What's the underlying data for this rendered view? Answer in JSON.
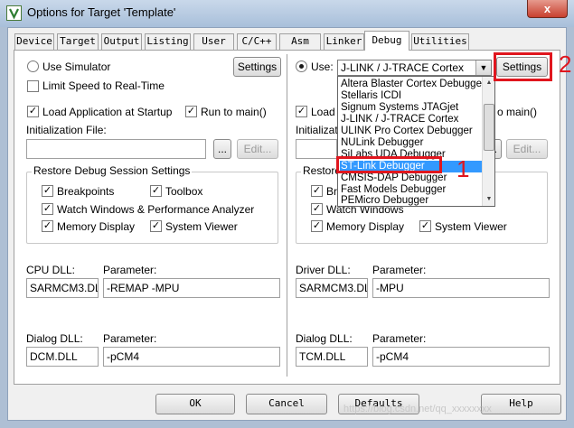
{
  "window": {
    "title": "Options for Target 'Template'",
    "close_label": "x"
  },
  "tabs": [
    {
      "label": "Device"
    },
    {
      "label": "Target"
    },
    {
      "label": "Output"
    },
    {
      "label": "Listing"
    },
    {
      "label": "User"
    },
    {
      "label": "C/C++"
    },
    {
      "label": "Asm"
    },
    {
      "label": "Linker"
    },
    {
      "label": "Debug"
    },
    {
      "label": "Utilities"
    }
  ],
  "left": {
    "use_simulator": "Use Simulator",
    "settings": "Settings",
    "limit_speed": "Limit Speed to Real-Time",
    "load_app": "Load Application at Startup",
    "run_to_main": "Run to main()",
    "init_file_label": "Initialization File:",
    "browse": "...",
    "edit": "Edit...",
    "restore_group": "Restore Debug Session Settings",
    "breakpoints": "Breakpoints",
    "toolbox": "Toolbox",
    "watch_windows": "Watch Windows & Performance Analyzer",
    "memory_display": "Memory Display",
    "system_viewer": "System Viewer",
    "cpu_dll_label": "CPU DLL:",
    "cpu_dll_value": "SARMCM3.DLL",
    "cpu_param_label": "Parameter:",
    "cpu_param_value": "-REMAP -MPU",
    "dialog_dll_label": "Dialog DLL:",
    "dialog_dll_value": "DCM.DLL",
    "dialog_param_label": "Parameter:",
    "dialog_param_value": "-pCM4"
  },
  "right": {
    "use": "Use:",
    "debugger_selected": "J-LINK / J-TRACE Cortex",
    "settings": "Settings",
    "load_partial": "Load",
    "run_partial": "o main()",
    "init_partial": "Initializati",
    "browse": "...",
    "edit": "Edit...",
    "restore_partial": "Restore",
    "breakpoints_partial": "Bre",
    "watch_partial": "Watch Windows",
    "memory_display": "Memory Display",
    "system_viewer": "System Viewer",
    "driver_dll_label": "Driver DLL:",
    "driver_dll_value": "SARMCM3.DLL",
    "driver_param_label": "Parameter:",
    "driver_param_value": "-MPU",
    "dialog_dll_label": "Dialog DLL:",
    "dialog_dll_value": "TCM.DLL",
    "dialog_param_label": "Parameter:",
    "dialog_param_value": "-pCM4"
  },
  "dropdown": {
    "items": [
      "Altera Blaster Cortex Debugger",
      "Stellaris ICDI",
      "Signum Systems JTAGjet",
      "J-LINK / J-TRACE Cortex",
      "ULINK Pro Cortex Debugger",
      "NULink Debugger",
      "SiLabs UDA Debugger",
      "ST-Link Debugger",
      "CMSIS-DAP Debugger",
      "Fast Models Debugger",
      "PEMicro Debugger"
    ],
    "selected_index": 7
  },
  "annotations": {
    "one": "1",
    "two": "2"
  },
  "buttons": {
    "ok": "OK",
    "cancel": "Cancel",
    "defaults": "Defaults",
    "help": "Help"
  },
  "watermark": "https://blog.csdn.net/qq_xxxxxxxx",
  "colors": {
    "accent_selection": "#3399ff",
    "annotation": "#e0161e"
  }
}
